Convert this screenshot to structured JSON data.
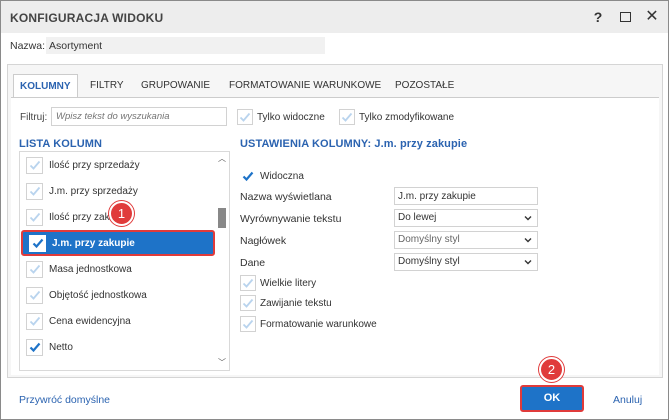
{
  "window": {
    "title": "KONFIGURACJA WIDOKU",
    "help_symbol": "?",
    "close_symbol": "✕"
  },
  "name_field": {
    "label": "Nazwa:",
    "value": "Asortyment"
  },
  "tabs": [
    {
      "label": "KOLUMNY",
      "active": true
    },
    {
      "label": "FILTRY",
      "active": false
    },
    {
      "label": "GRUPOWANIE",
      "active": false
    },
    {
      "label": "FORMATOWANIE WARUNKOWE",
      "active": false
    },
    {
      "label": "POZOSTAŁE",
      "active": false
    }
  ],
  "filter": {
    "label": "Filtruj:",
    "placeholder": "Wpisz tekst do wyszukania",
    "only_visible": {
      "label": "Tylko widoczne",
      "checked": false
    },
    "only_modified": {
      "label": "Tylko zmodyfikowane",
      "checked": false
    }
  },
  "column_list": {
    "title": "LISTA KOLUMN",
    "items": [
      {
        "label": "Ilość przy sprzedaży",
        "checked": false,
        "selected": false
      },
      {
        "label": "J.m. przy sprzedaży",
        "checked": false,
        "selected": false
      },
      {
        "label": "Ilość przy zakupie",
        "checked": false,
        "selected": false
      },
      {
        "label": "J.m. przy zakupie",
        "checked": true,
        "selected": true
      },
      {
        "label": "Masa jednostkowa",
        "checked": false,
        "selected": false
      },
      {
        "label": "Objętość jednostkowa",
        "checked": false,
        "selected": false
      },
      {
        "label": "Cena ewidencyjna",
        "checked": false,
        "selected": false
      },
      {
        "label": "Netto",
        "checked": true,
        "selected": false
      }
    ]
  },
  "column_settings": {
    "title": "USTAWIENIA KOLUMNY: J.m. przy zakupie",
    "visible": {
      "label": "Widoczna",
      "checked": true
    },
    "display_name": {
      "label": "Nazwa wyświetlana",
      "value": "J.m. przy zakupie"
    },
    "text_alignment": {
      "label": "Wyrównywanie tekstu",
      "value": "Do lewej"
    },
    "header": {
      "label": "Nagłówek",
      "value": "Domyślny styl"
    },
    "data": {
      "label": "Dane",
      "value": "Domyślny styl"
    },
    "uppercase": {
      "label": "Wielkie litery",
      "checked": false
    },
    "wrap_text": {
      "label": "Zawijanie tekstu",
      "checked": false
    },
    "conditional_formatting": {
      "label": "Formatowanie warunkowe",
      "checked": false
    }
  },
  "annotations": {
    "badge_1": "1",
    "badge_2": "2"
  },
  "footer": {
    "restore_defaults": "Przywróć domyślne",
    "ok": "OK",
    "cancel": "Anuluj"
  },
  "colors": {
    "accent": "#2b63b0",
    "selection": "#1e73c8",
    "highlight": "#e03b3b",
    "check_checked": "#1e73c8",
    "check_unchecked": "#b9d4ee"
  }
}
